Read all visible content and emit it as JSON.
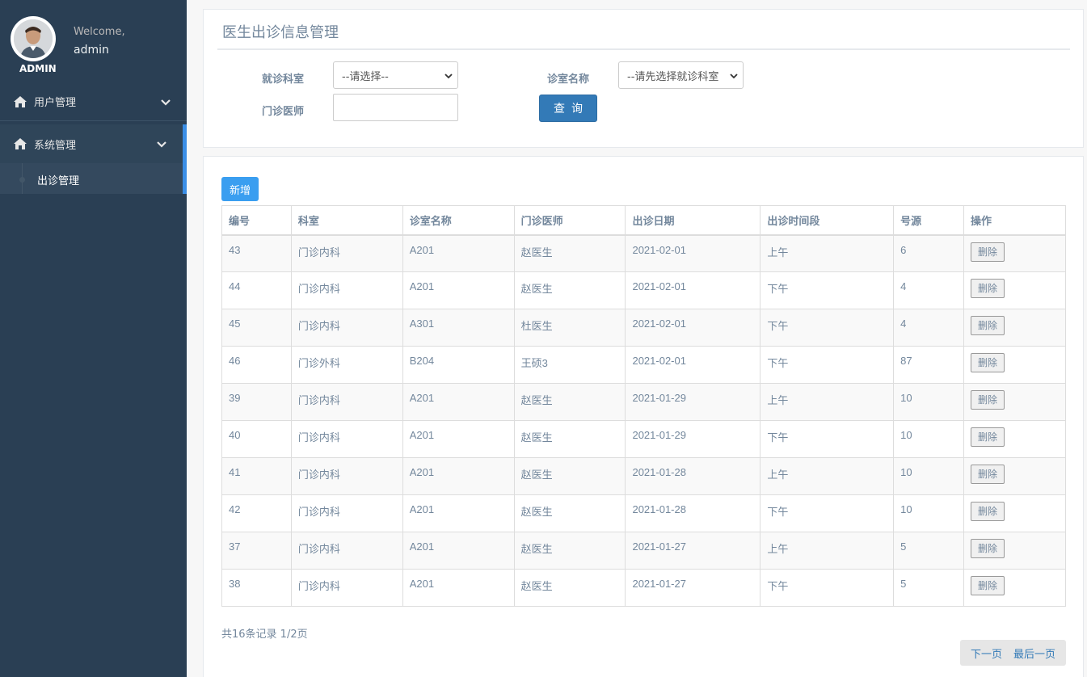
{
  "sidebar": {
    "welcome": "Welcome,",
    "username": "admin",
    "role": "ADMIN",
    "menu": [
      {
        "label": "用户管理",
        "icon": "home-icon"
      },
      {
        "label": "系统管理",
        "icon": "home-icon"
      }
    ],
    "submenu": [
      {
        "label": "出诊管理"
      }
    ]
  },
  "search": {
    "title": "医生出诊信息管理",
    "dept_label": "就诊科室",
    "dept_value": "--请选择--",
    "room_label": "诊室名称",
    "room_value": "--请先选择就诊科室",
    "doctor_label": "门诊医师",
    "doctor_value": "",
    "query_label": "查询"
  },
  "main": {
    "add_label": "新增",
    "columns": [
      "编号",
      "科室",
      "诊室名称",
      "门诊医师",
      "出诊日期",
      "出诊时间段",
      "号源",
      "操作"
    ],
    "rows": [
      {
        "id": "43",
        "dept": "门诊内科",
        "room": "A201",
        "doctor": "赵医生",
        "date": "2021-02-01",
        "period": "上午",
        "slots": "6",
        "action": "删除"
      },
      {
        "id": "44",
        "dept": "门诊内科",
        "room": "A201",
        "doctor": "赵医生",
        "date": "2021-02-01",
        "period": "下午",
        "slots": "4",
        "action": "删除"
      },
      {
        "id": "45",
        "dept": "门诊内科",
        "room": "A301",
        "doctor": "杜医生",
        "date": "2021-02-01",
        "period": "下午",
        "slots": "4",
        "action": "删除"
      },
      {
        "id": "46",
        "dept": "门诊外科",
        "room": "B204",
        "doctor": "王硕3",
        "date": "2021-02-01",
        "period": "下午",
        "slots": "87",
        "action": "删除"
      },
      {
        "id": "39",
        "dept": "门诊内科",
        "room": "A201",
        "doctor": "赵医生",
        "date": "2021-01-29",
        "period": "上午",
        "slots": "10",
        "action": "删除"
      },
      {
        "id": "40",
        "dept": "门诊内科",
        "room": "A201",
        "doctor": "赵医生",
        "date": "2021-01-29",
        "period": "下午",
        "slots": "10",
        "action": "删除"
      },
      {
        "id": "41",
        "dept": "门诊内科",
        "room": "A201",
        "doctor": "赵医生",
        "date": "2021-01-28",
        "period": "上午",
        "slots": "10",
        "action": "删除"
      },
      {
        "id": "42",
        "dept": "门诊内科",
        "room": "A201",
        "doctor": "赵医生",
        "date": "2021-01-28",
        "period": "下午",
        "slots": "10",
        "action": "删除"
      },
      {
        "id": "37",
        "dept": "门诊内科",
        "room": "A201",
        "doctor": "赵医生",
        "date": "2021-01-27",
        "period": "上午",
        "slots": "5",
        "action": "删除"
      },
      {
        "id": "38",
        "dept": "门诊内科",
        "room": "A201",
        "doctor": "赵医生",
        "date": "2021-01-27",
        "period": "下午",
        "slots": "5",
        "action": "删除"
      }
    ],
    "summary": "共16条记录 1/2页",
    "next_label": "下一页",
    "last_label": "最后一页"
  },
  "colors": {
    "sidebar_bg": "#2a3f54",
    "accent_blue": "#337ab7",
    "add_button": "#3a9ef0"
  }
}
